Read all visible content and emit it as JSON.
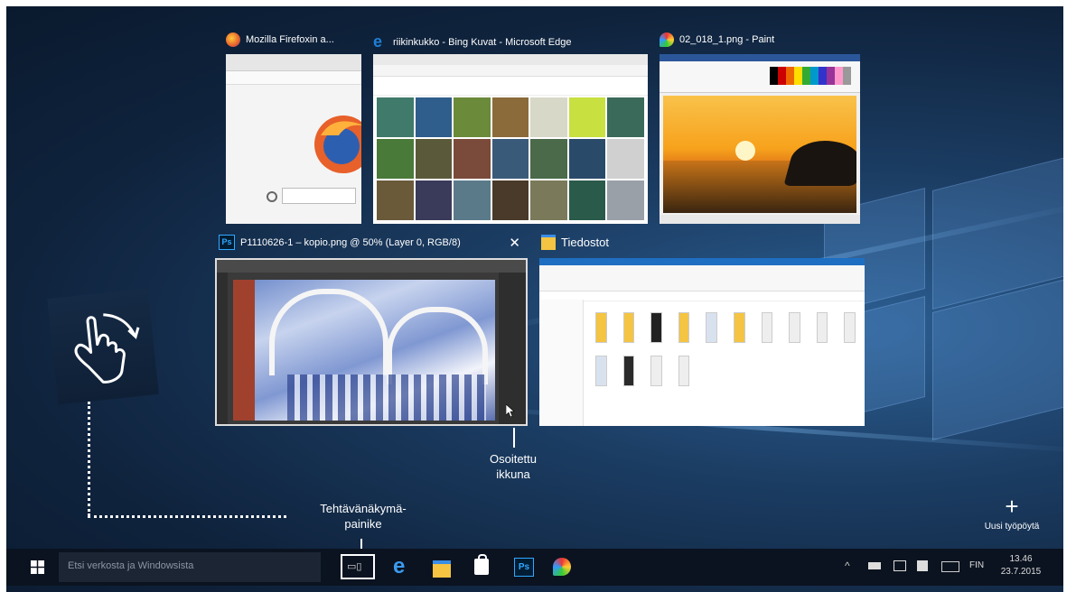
{
  "windows": [
    {
      "title": "Mozilla Firefoxin a..."
    },
    {
      "title": "riikinkukko - Bing Kuvat - Microsoft Edge"
    },
    {
      "title": "02_018_1.png - Paint"
    },
    {
      "title": "P1110626-1 – kopio.png @ 50% (Layer 0, RGB/8)",
      "close_glyph": "✕"
    },
    {
      "title": "Tiedostot"
    }
  ],
  "annotations": {
    "pointed_window_line1": "Osoitettu",
    "pointed_window_line2": "ikkuna",
    "task_view_button_line1": "Tehtävänäkymä-",
    "task_view_button_line2": "painike"
  },
  "new_desktop": {
    "icon": "+",
    "label": "Uusi työpöytä"
  },
  "taskbar": {
    "search_placeholder": "Etsi verkosta ja Windowsista",
    "task_view_glyph": "▭▯",
    "ps_glyph": "Ps",
    "language": "FIN",
    "time": "13.46",
    "date": "23.7.2015"
  },
  "colors": {
    "accent_orange": "#e8862a",
    "edge_blue": "#1e7fd6",
    "ps_blue": "#31a8ff",
    "folder_yellow": "#f4c442"
  }
}
